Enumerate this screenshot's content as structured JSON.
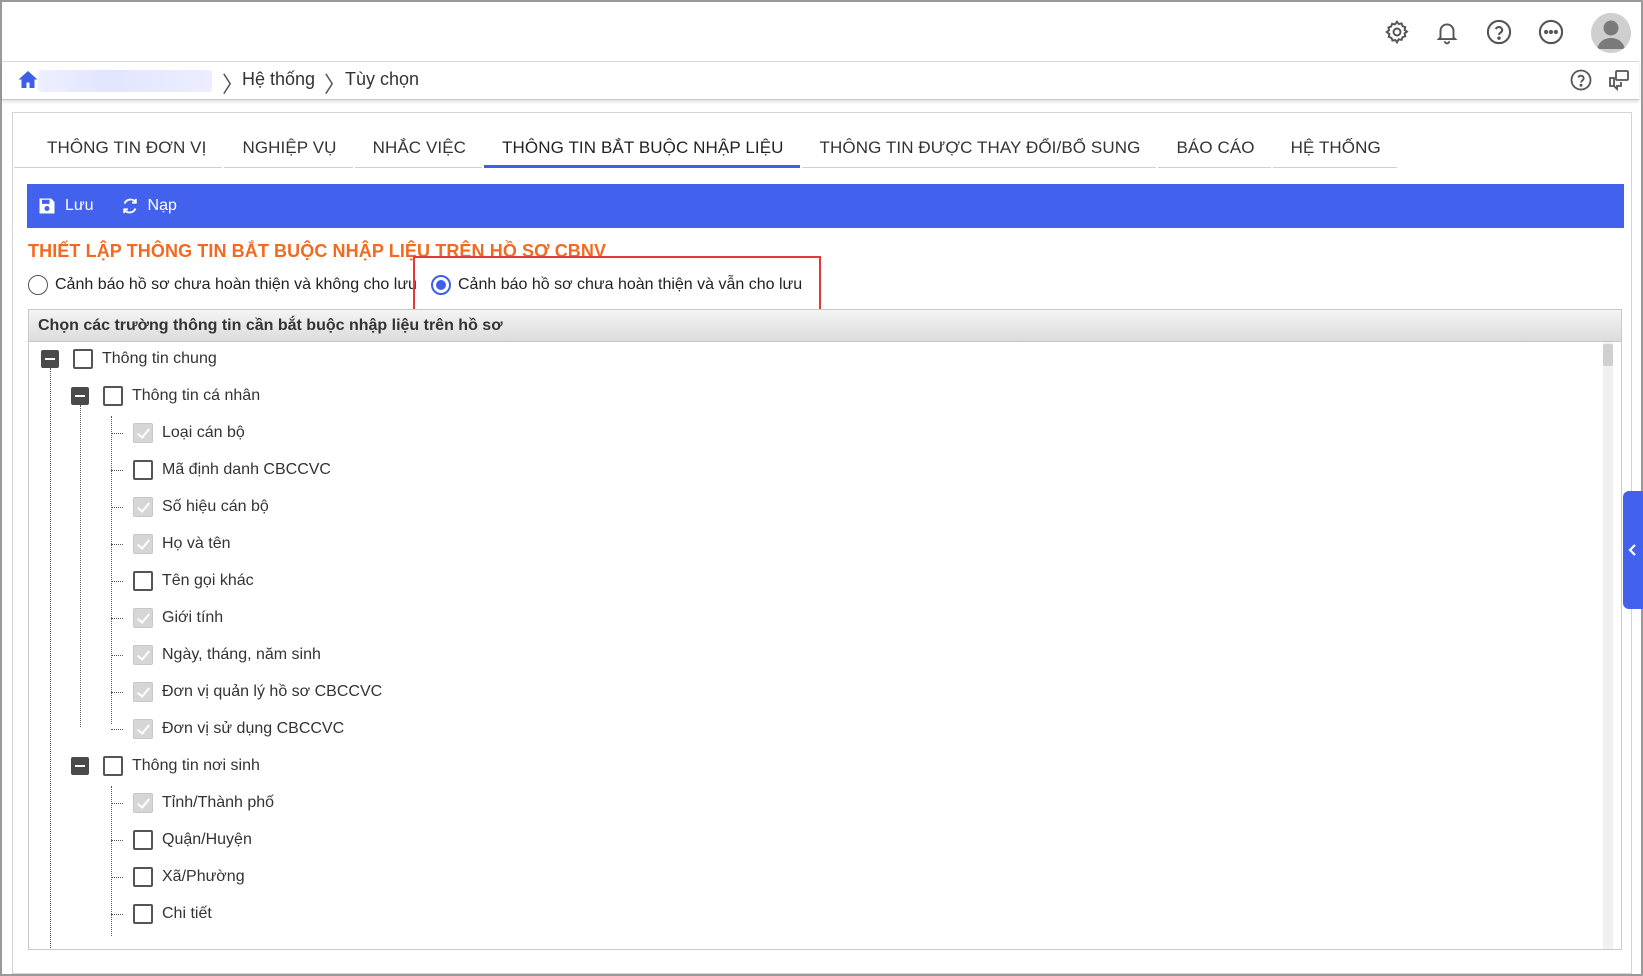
{
  "header": {
    "icons": [
      "gear-icon",
      "bell-icon",
      "help-icon",
      "more-icon",
      "user-avatar"
    ]
  },
  "breadcrumb": {
    "items": [
      "Hệ thống",
      "Tùy chọn"
    ]
  },
  "tabs": [
    {
      "label": "THÔNG TIN ĐƠN VỊ"
    },
    {
      "label": "NGHIỆP VỤ"
    },
    {
      "label": "NHẮC VIỆC"
    },
    {
      "label": "THÔNG TIN BẮT BUỘC NHẬP LIỆU",
      "active": true
    },
    {
      "label": "THÔNG TIN ĐƯỢC THAY ĐỔI/BỔ SUNG"
    },
    {
      "label": "BÁO CÁO"
    },
    {
      "label": "HỆ THỐNG"
    }
  ],
  "toolbar": {
    "save_label": "Lưu",
    "reload_label": "Nạp"
  },
  "section": {
    "title": "THIẾT LẬP THÔNG TIN BẮT BUỘC NHẬP LIỆU TRÊN HỒ SƠ CBNV",
    "option_block": "Cảnh báo hồ sơ chưa hoàn thiện và không cho lưu",
    "option_allow": "Cảnh báo hồ sơ chưa hoàn thiện và vẫn cho lưu",
    "selected_option": "option_allow"
  },
  "tree": {
    "header": "Chọn các trường thông tin cần bắt buộc nhập liệu trên hồ sơ",
    "nodes": [
      {
        "label": "Thông tin chung",
        "level": 0,
        "checked": false,
        "expandable": true
      },
      {
        "label": "Thông tin cá nhân",
        "level": 1,
        "checked": false,
        "expandable": true
      },
      {
        "label": "Loại cán bộ",
        "level": 2,
        "checked": true
      },
      {
        "label": "Mã định danh CBCCVC",
        "level": 2,
        "checked": false
      },
      {
        "label": "Số hiệu cán bộ",
        "level": 2,
        "checked": true
      },
      {
        "label": "Họ và tên",
        "level": 2,
        "checked": true
      },
      {
        "label": "Tên gọi khác",
        "level": 2,
        "checked": false
      },
      {
        "label": "Giới tính",
        "level": 2,
        "checked": true
      },
      {
        "label": "Ngày, tháng, năm sinh",
        "level": 2,
        "checked": true
      },
      {
        "label": "Đơn vị quản lý hồ sơ CBCCVC",
        "level": 2,
        "checked": true
      },
      {
        "label": "Đơn vị sử dụng CBCCVC",
        "level": 2,
        "checked": true
      },
      {
        "label": "Thông tin nơi sinh",
        "level": 1,
        "checked": false,
        "expandable": true
      },
      {
        "label": "Tỉnh/Thành phố",
        "level": 2,
        "checked": true
      },
      {
        "label": "Quận/Huyện",
        "level": 2,
        "checked": false
      },
      {
        "label": "Xã/Phường",
        "level": 2,
        "checked": false
      },
      {
        "label": "Chi tiết",
        "level": 2,
        "checked": false
      }
    ]
  },
  "colors": {
    "accent": "#4262ee",
    "title": "#f26a21",
    "highlight": "#e53935"
  }
}
